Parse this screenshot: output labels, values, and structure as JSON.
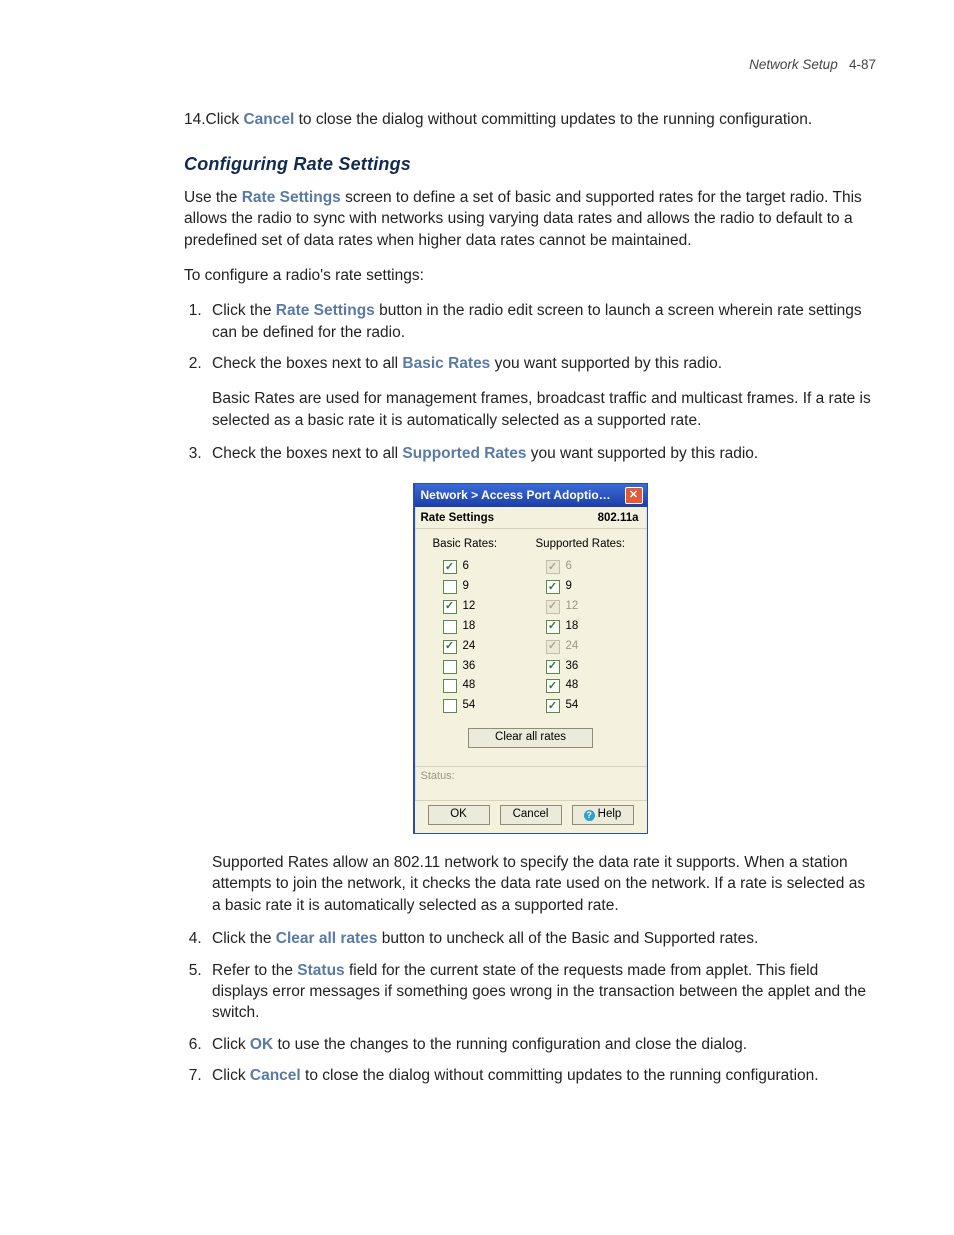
{
  "header": {
    "section": "Network Setup",
    "page": "4-87"
  },
  "step14": {
    "prefix": "14.Click ",
    "bold": "Cancel",
    "suffix": " to close the dialog without committing updates to the running configuration."
  },
  "heading": "Configuring Rate Settings",
  "intro": {
    "p1a": "Use the ",
    "p1b": "Rate Settings",
    "p1c": " screen to define a set of basic and supported rates for the target radio. This allows the radio to sync with networks using varying data rates and allows the radio to default to a predefined set of data rates when higher data rates cannot be maintained."
  },
  "lead": "To configure a radio's rate settings:",
  "step1": {
    "a": "Click the ",
    "b": "Rate Settings",
    "c": " button in the radio edit screen to launch a screen wherein rate settings can be defined for the radio."
  },
  "step2": {
    "a": "Check the boxes next to all ",
    "b": "Basic Rates",
    "c": " you want supported by this radio."
  },
  "step2note": "Basic Rates are used for management frames, broadcast traffic and multicast frames. If a rate is selected as a basic rate it is automatically selected as a supported rate.",
  "step3": {
    "a": "Check the boxes next to all ",
    "b": "Supported Rates",
    "c": " you want supported by this radio."
  },
  "step3note": "Supported Rates allow an 802.11 network to specify the data rate it supports. When a station attempts to join the network, it checks the data rate used on the network. If a rate is selected as a basic rate it is automatically selected as a supported rate.",
  "step4": {
    "a": "Click the ",
    "b": "Clear all rates",
    "c": " button to uncheck all of the Basic and Supported rates."
  },
  "step5": {
    "a": "Refer to the ",
    "b": "Status",
    "c": " field for the current state of the requests made from applet. This field displays error messages if something goes wrong in the transaction between the applet and the switch."
  },
  "step6": {
    "a": "Click ",
    "b": "OK",
    "c": " to use the changes to the running configuration and close the dialog."
  },
  "step7": {
    "a": "Click ",
    "b": "Cancel",
    "c": " to close the dialog without committing updates to the running configuration."
  },
  "dialog": {
    "title": "Network > Access Port Adoption Def…",
    "left": "Rate Settings",
    "right": "802.11a",
    "col1": "Basic Rates:",
    "col2": "Supported Rates:",
    "basic": [
      {
        "v": "6",
        "c": true
      },
      {
        "v": "9",
        "c": false
      },
      {
        "v": "12",
        "c": true
      },
      {
        "v": "18",
        "c": false
      },
      {
        "v": "24",
        "c": true
      },
      {
        "v": "36",
        "c": false
      },
      {
        "v": "48",
        "c": false
      },
      {
        "v": "54",
        "c": false
      }
    ],
    "supported": [
      {
        "v": "6",
        "c": true,
        "d": true
      },
      {
        "v": "9",
        "c": true,
        "d": false
      },
      {
        "v": "12",
        "c": true,
        "d": true
      },
      {
        "v": "18",
        "c": true,
        "d": false
      },
      {
        "v": "24",
        "c": true,
        "d": true
      },
      {
        "v": "36",
        "c": true,
        "d": false
      },
      {
        "v": "48",
        "c": true,
        "d": false
      },
      {
        "v": "54",
        "c": true,
        "d": false
      }
    ],
    "clear": "Clear all rates",
    "status": "Status:",
    "ok": "OK",
    "cancel": "Cancel",
    "help": "Help"
  }
}
